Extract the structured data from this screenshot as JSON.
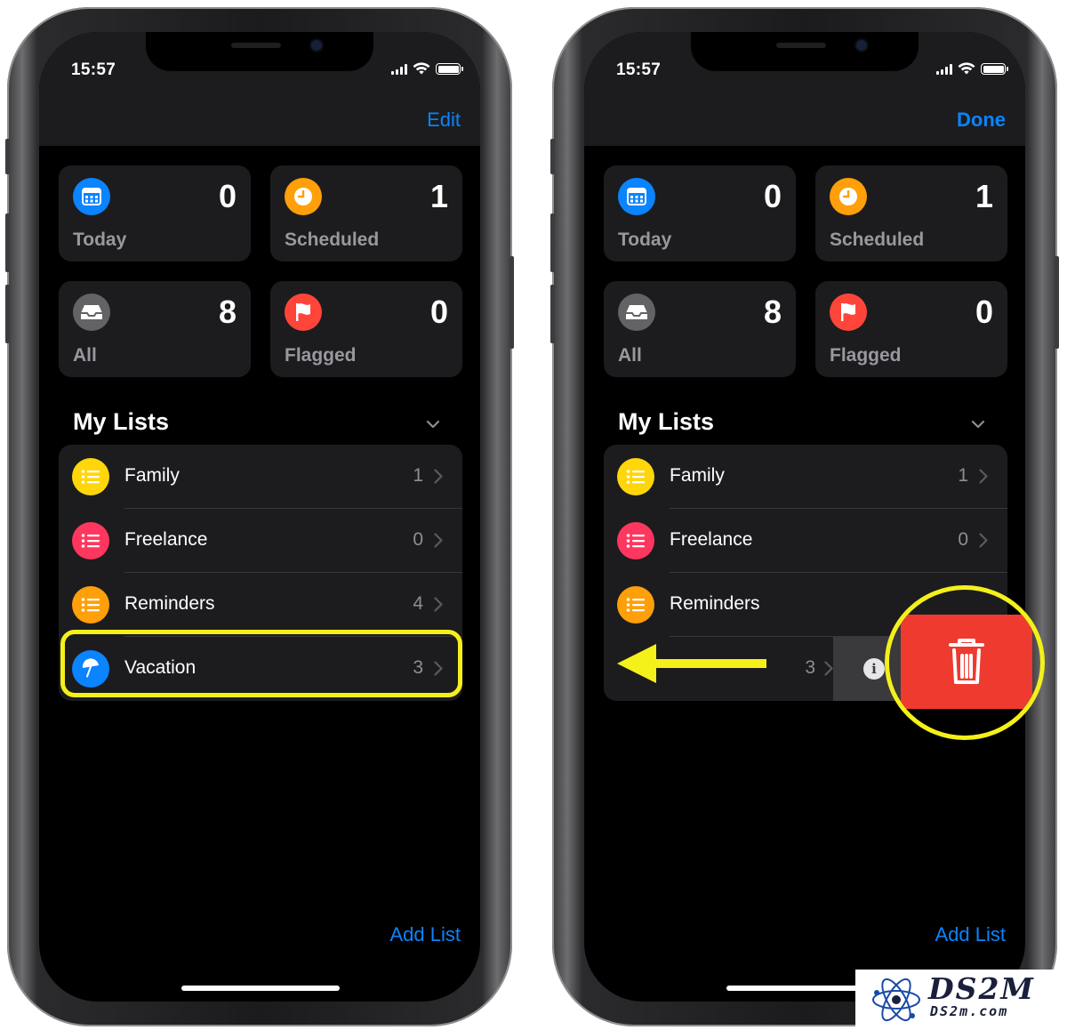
{
  "status_bar": {
    "time": "15:57"
  },
  "screens": [
    {
      "nav_action": "Edit",
      "tiles": [
        {
          "label": "Today",
          "count": "0",
          "icon": "calendar-icon",
          "color": "#0a84ff"
        },
        {
          "label": "Scheduled",
          "count": "1",
          "icon": "clock-icon",
          "color": "#ff9f0a"
        },
        {
          "label": "All",
          "count": "8",
          "icon": "tray-icon",
          "color": "#636366"
        },
        {
          "label": "Flagged",
          "count": "0",
          "icon": "flag-icon",
          "color": "#ff453a"
        }
      ],
      "section_title": "My Lists",
      "lists": [
        {
          "name": "Family",
          "count": "1",
          "icon": "list-icon",
          "color": "#ffd60a"
        },
        {
          "name": "Freelance",
          "count": "0",
          "icon": "list-icon",
          "color": "#ff375f"
        },
        {
          "name": "Reminders",
          "count": "4",
          "icon": "list-icon",
          "color": "#ff9f0a"
        },
        {
          "name": "Vacation",
          "count": "3",
          "icon": "umbrella-icon",
          "color": "#0a84ff"
        }
      ],
      "add_list": "Add List"
    },
    {
      "nav_action": "Done",
      "tiles": [
        {
          "label": "Today",
          "count": "0",
          "icon": "calendar-icon",
          "color": "#0a84ff"
        },
        {
          "label": "Scheduled",
          "count": "1",
          "icon": "clock-icon",
          "color": "#ff9f0a"
        },
        {
          "label": "All",
          "count": "8",
          "icon": "tray-icon",
          "color": "#636366"
        },
        {
          "label": "Flagged",
          "count": "0",
          "icon": "flag-icon",
          "color": "#ff453a"
        }
      ],
      "section_title": "My Lists",
      "lists": [
        {
          "name": "Family",
          "count": "1",
          "icon": "list-icon",
          "color": "#ffd60a"
        },
        {
          "name": "Freelance",
          "count": "0",
          "icon": "list-icon",
          "color": "#ff375f"
        },
        {
          "name": "Reminders",
          "icon": "list-icon",
          "color": "#ff9f0a"
        },
        {
          "count": "3",
          "swiped": true,
          "actions": [
            "info",
            "delete"
          ]
        }
      ],
      "add_list": "Add List"
    }
  ],
  "watermark": {
    "title": "DS2M",
    "subtitle": "DS2m.com"
  },
  "colors": {
    "highlight": "#f4f01a",
    "delete": "#ff3b30",
    "accent": "#0a84ff"
  }
}
